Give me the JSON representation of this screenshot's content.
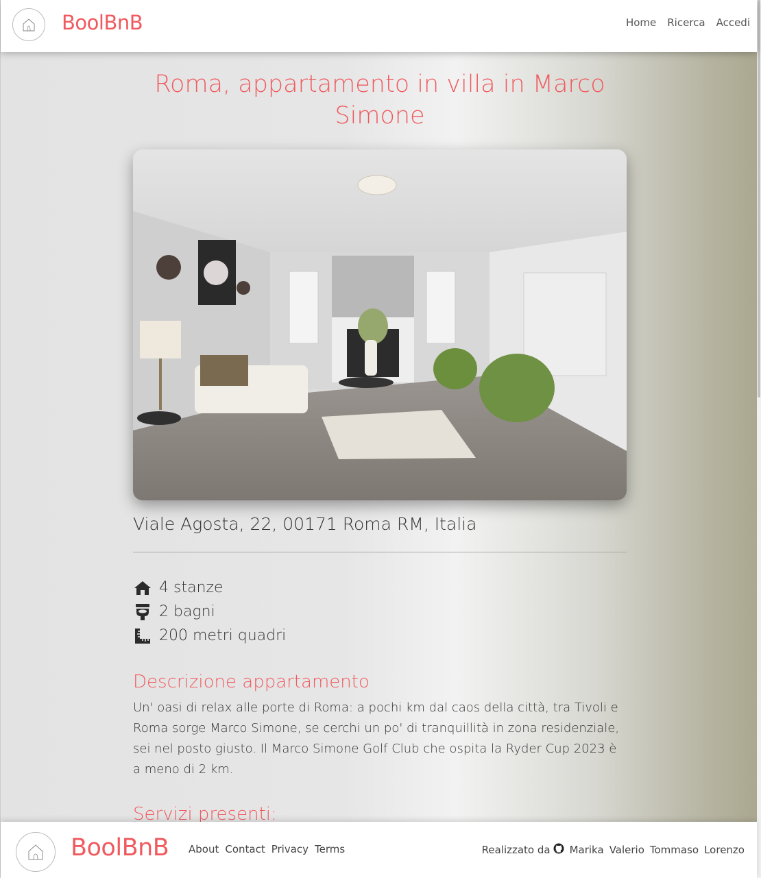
{
  "header": {
    "brand": "BoolBnB",
    "nav": [
      {
        "label": "Home"
      },
      {
        "label": "Ricerca"
      },
      {
        "label": "Accedi"
      }
    ]
  },
  "listing": {
    "title": "Roma, appartamento in villa in Marco Simone",
    "address": "Viale Agosta, 22, 00171 Roma RM, Italia",
    "features": {
      "rooms": "4 stanze",
      "bathrooms": "2 bagni",
      "area": "200 metri quadri"
    },
    "description_title": "Descrizione appartamento",
    "description": "Un' oasi di relax alle porte di Roma: a pochi km dal caos della città, tra Tivoli e Roma sorge Marco Simone, se cerchi un po' di tranquillità in zona residenziale, sei nel posto giusto. Il Marco Simone Golf Club che ospita la Ryder Cup 2023 è a meno di 2 km.",
    "services_title": "Servizi presenti:"
  },
  "footer": {
    "brand": "BoolBnB",
    "links": [
      {
        "label": "About"
      },
      {
        "label": "Contact"
      },
      {
        "label": "Privacy"
      },
      {
        "label": "Terms"
      }
    ],
    "credits_label": "Realizzato da",
    "authors": [
      {
        "name": "Marika"
      },
      {
        "name": "Valerio"
      },
      {
        "name": "Tommaso"
      },
      {
        "name": "Lorenzo"
      }
    ]
  },
  "icons": {
    "logo": "house-logo-icon",
    "rooms": "house-icon",
    "bathrooms": "toilet-icon",
    "area": "ruler-icon",
    "github": "github-icon"
  },
  "colors": {
    "brand": "#f05a5f"
  }
}
